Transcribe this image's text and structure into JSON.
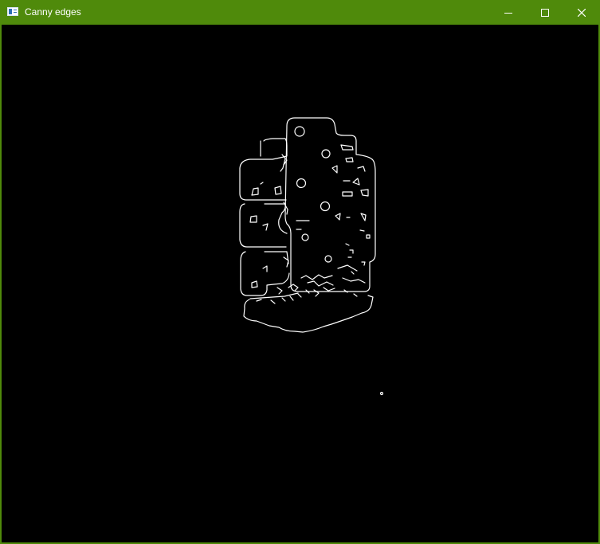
{
  "window": {
    "title": "Canny edges",
    "frame_color": "#4f8a0b",
    "title_text_color": "#ffffff",
    "canvas_background": "#000000",
    "edge_color": "#ffffff"
  },
  "controls": {
    "minimize_icon": "minimize-icon",
    "maximize_icon": "maximize-icon",
    "close_icon": "close-icon"
  }
}
